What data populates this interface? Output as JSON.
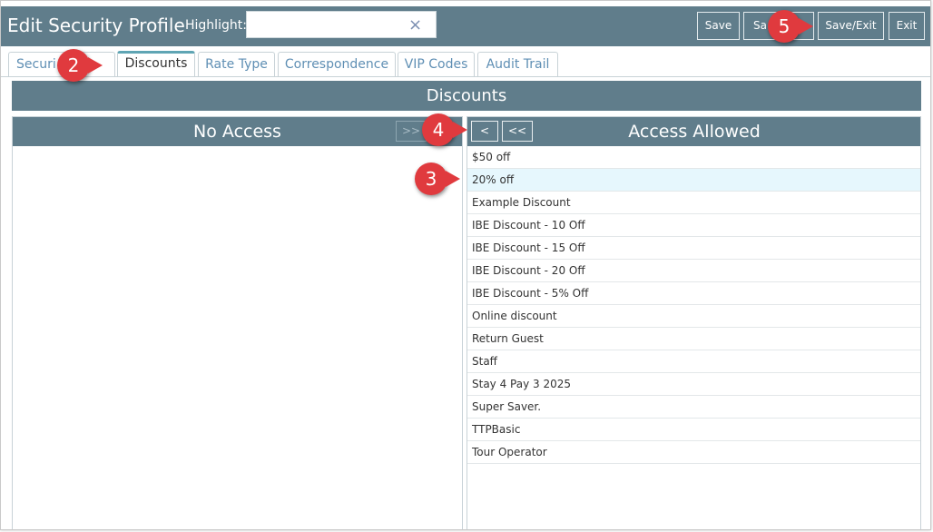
{
  "header": {
    "title": "Edit Security Profile",
    "highlight_label": "Highlight:",
    "highlight_value": "",
    "clear_icon": "×",
    "buttons": {
      "save": "Save",
      "save_close": "Sa",
      "save_exit": "Save/Exit",
      "exit": "Exit"
    }
  },
  "tabs": [
    {
      "label": "Securi"
    },
    {
      "label": "Discounts"
    },
    {
      "label": "Rate Type"
    },
    {
      "label": "Correspondence"
    },
    {
      "label": "VIP Codes"
    },
    {
      "label": "Audit Trail"
    }
  ],
  "section_title": "Discounts",
  "no_access": {
    "title": "No Access",
    "move_right_label": ">>",
    "items": []
  },
  "access_allowed": {
    "title": "Access Allowed",
    "move_left_label": "<",
    "move_all_left_label": "<<",
    "items": [
      "$50 off",
      "20% off",
      "Example Discount",
      "IBE Discount - 10 Off",
      "IBE Discount - 15 Off",
      "IBE Discount - 20 Off",
      "IBE Discount - 5% Off",
      "Online discount",
      "Return Guest",
      "Staff",
      "Stay 4 Pay 3 2025",
      "Super Saver.",
      "TTPBasic",
      "Tour Operator"
    ],
    "selected_item": "20% off"
  },
  "callouts": [
    "2",
    "3",
    "4",
    "5"
  ],
  "colors": {
    "header": "#607d8b",
    "callout": "#e03a3e",
    "selected_row": "#e6f7fd",
    "tab_link": "#5f8fb4"
  }
}
